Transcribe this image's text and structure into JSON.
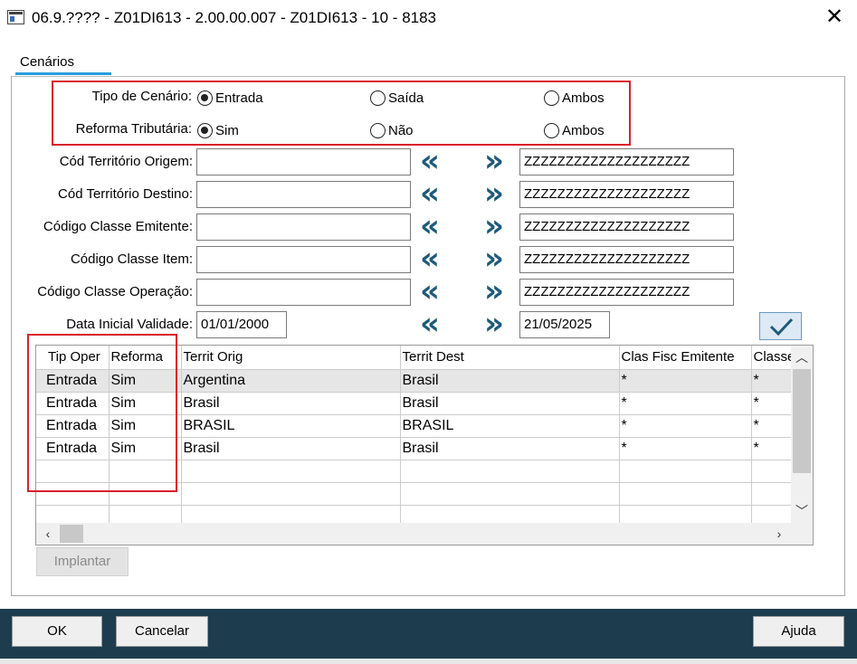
{
  "window": {
    "title": "06.9.???? - Z01DI613 - 2.00.00.007 - Z01DI613 - 10 - 8183",
    "close_glyph": "✕"
  },
  "tab": {
    "label": "Cenários"
  },
  "tipo_cenario": {
    "label": "Tipo de Cenário:",
    "options": [
      "Entrada",
      "Saída",
      "Ambos"
    ],
    "selected": "Entrada"
  },
  "reforma": {
    "label": "Reforma Tributária:",
    "options": [
      "Sim",
      "Não",
      "Ambos"
    ],
    "selected": "Sim"
  },
  "ranges": [
    {
      "label": "Cód Território Origem:",
      "from": "",
      "to": "ZZZZZZZZZZZZZZZZZZZZ"
    },
    {
      "label": "Cód Território Destino:",
      "from": "",
      "to": "ZZZZZZZZZZZZZZZZZZZZ"
    },
    {
      "label": "Código Classe Emitente:",
      "from": "",
      "to": "ZZZZZZZZZZZZZZZZZZZZ"
    },
    {
      "label": "Código Classe Item:",
      "from": "",
      "to": "ZZZZZZZZZZZZZZZZZZZZ"
    },
    {
      "label": "Código Classe Operação:",
      "from": "",
      "to": "ZZZZZZZZZZZZZZZZZZZZ"
    },
    {
      "label": "Data Inicial Validade:",
      "from": "01/01/2000",
      "to": "21/05/2025"
    }
  ],
  "arrows": {
    "first": "«",
    "last": "»"
  },
  "grid": {
    "columns": [
      "Tip Oper",
      "Reforma",
      "Territ Orig",
      "Territ Dest",
      "Clas Fisc Emitente",
      "Classe"
    ],
    "rows": [
      [
        "Entrada",
        "Sim",
        "Argentina",
        "Brasil",
        "*",
        "*"
      ],
      [
        "Entrada",
        "Sim",
        "Brasil",
        "Brasil",
        "*",
        "*"
      ],
      [
        "Entrada",
        "Sim",
        "BRASIL",
        "BRASIL",
        "*",
        "*"
      ],
      [
        "Entrada",
        "Sim",
        "Brasil",
        "Brasil",
        "*",
        "*"
      ],
      [
        "",
        "",
        "",
        "",
        "",
        ""
      ],
      [
        "",
        "",
        "",
        "",
        "",
        ""
      ],
      [
        "",
        "",
        "",
        "",
        "",
        ""
      ]
    ]
  },
  "buttons": {
    "implantar": "Implantar",
    "ok": "OK",
    "cancelar": "Cancelar",
    "ajuda": "Ajuda"
  },
  "colors": {
    "footer": "#1d3d4e",
    "highlight": "#d9212a",
    "tab_accent": "#2a9ddc",
    "arrow": "#1e5a7a"
  }
}
